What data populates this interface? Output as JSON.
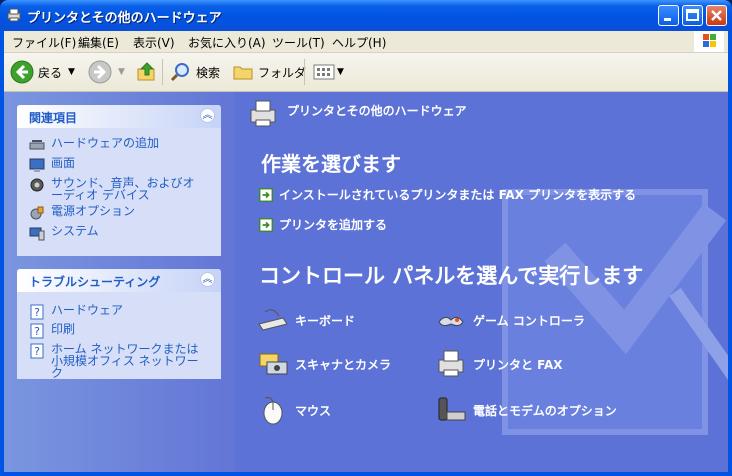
{
  "window": {
    "title": "プリンタとその他のハードウェア",
    "controls": {
      "minimize": "_",
      "maximize": "□",
      "close": "✕"
    }
  },
  "menubar": [
    "ファイル(F)",
    "編集(E)",
    "表示(V)",
    "お気に入り(A)",
    "ツール(T)",
    "ヘルプ(H)"
  ],
  "toolbar": {
    "back": "戻る",
    "search": "検索",
    "folders": "フォルダ"
  },
  "sidebar": {
    "related": {
      "title": "関連項目",
      "items": [
        "ハードウェアの追加",
        "画面",
        "サウンド、音声、およびオーディオ デバイス",
        "電源オプション",
        "システム"
      ]
    },
    "troubleshoot": {
      "title": "トラブルシューティング",
      "items": [
        "ハードウェア",
        "印刷",
        "ホーム ネットワークまたは小規模オフィス ネットワーク"
      ]
    }
  },
  "main": {
    "header": "プリンタとその他のハードウェア",
    "task_heading": "作業を選びます",
    "tasks": [
      "インストールされているプリンタまたは FAX プリンタを表示する",
      "プリンタを追加する"
    ],
    "panel_heading": "コントロール パネルを選んで実行します",
    "categories": [
      "キーボード",
      "ゲーム コントローラ",
      "スキャナとカメラ",
      "プリンタと FAX",
      "マウス",
      "電話とモデムのオプション"
    ]
  },
  "colors": {
    "title_bar": "#0054e3",
    "right_pane": "#5c72d6",
    "left_pane": "#6375d6",
    "panel_body": "#d6dff7",
    "link": "#215dc6"
  }
}
